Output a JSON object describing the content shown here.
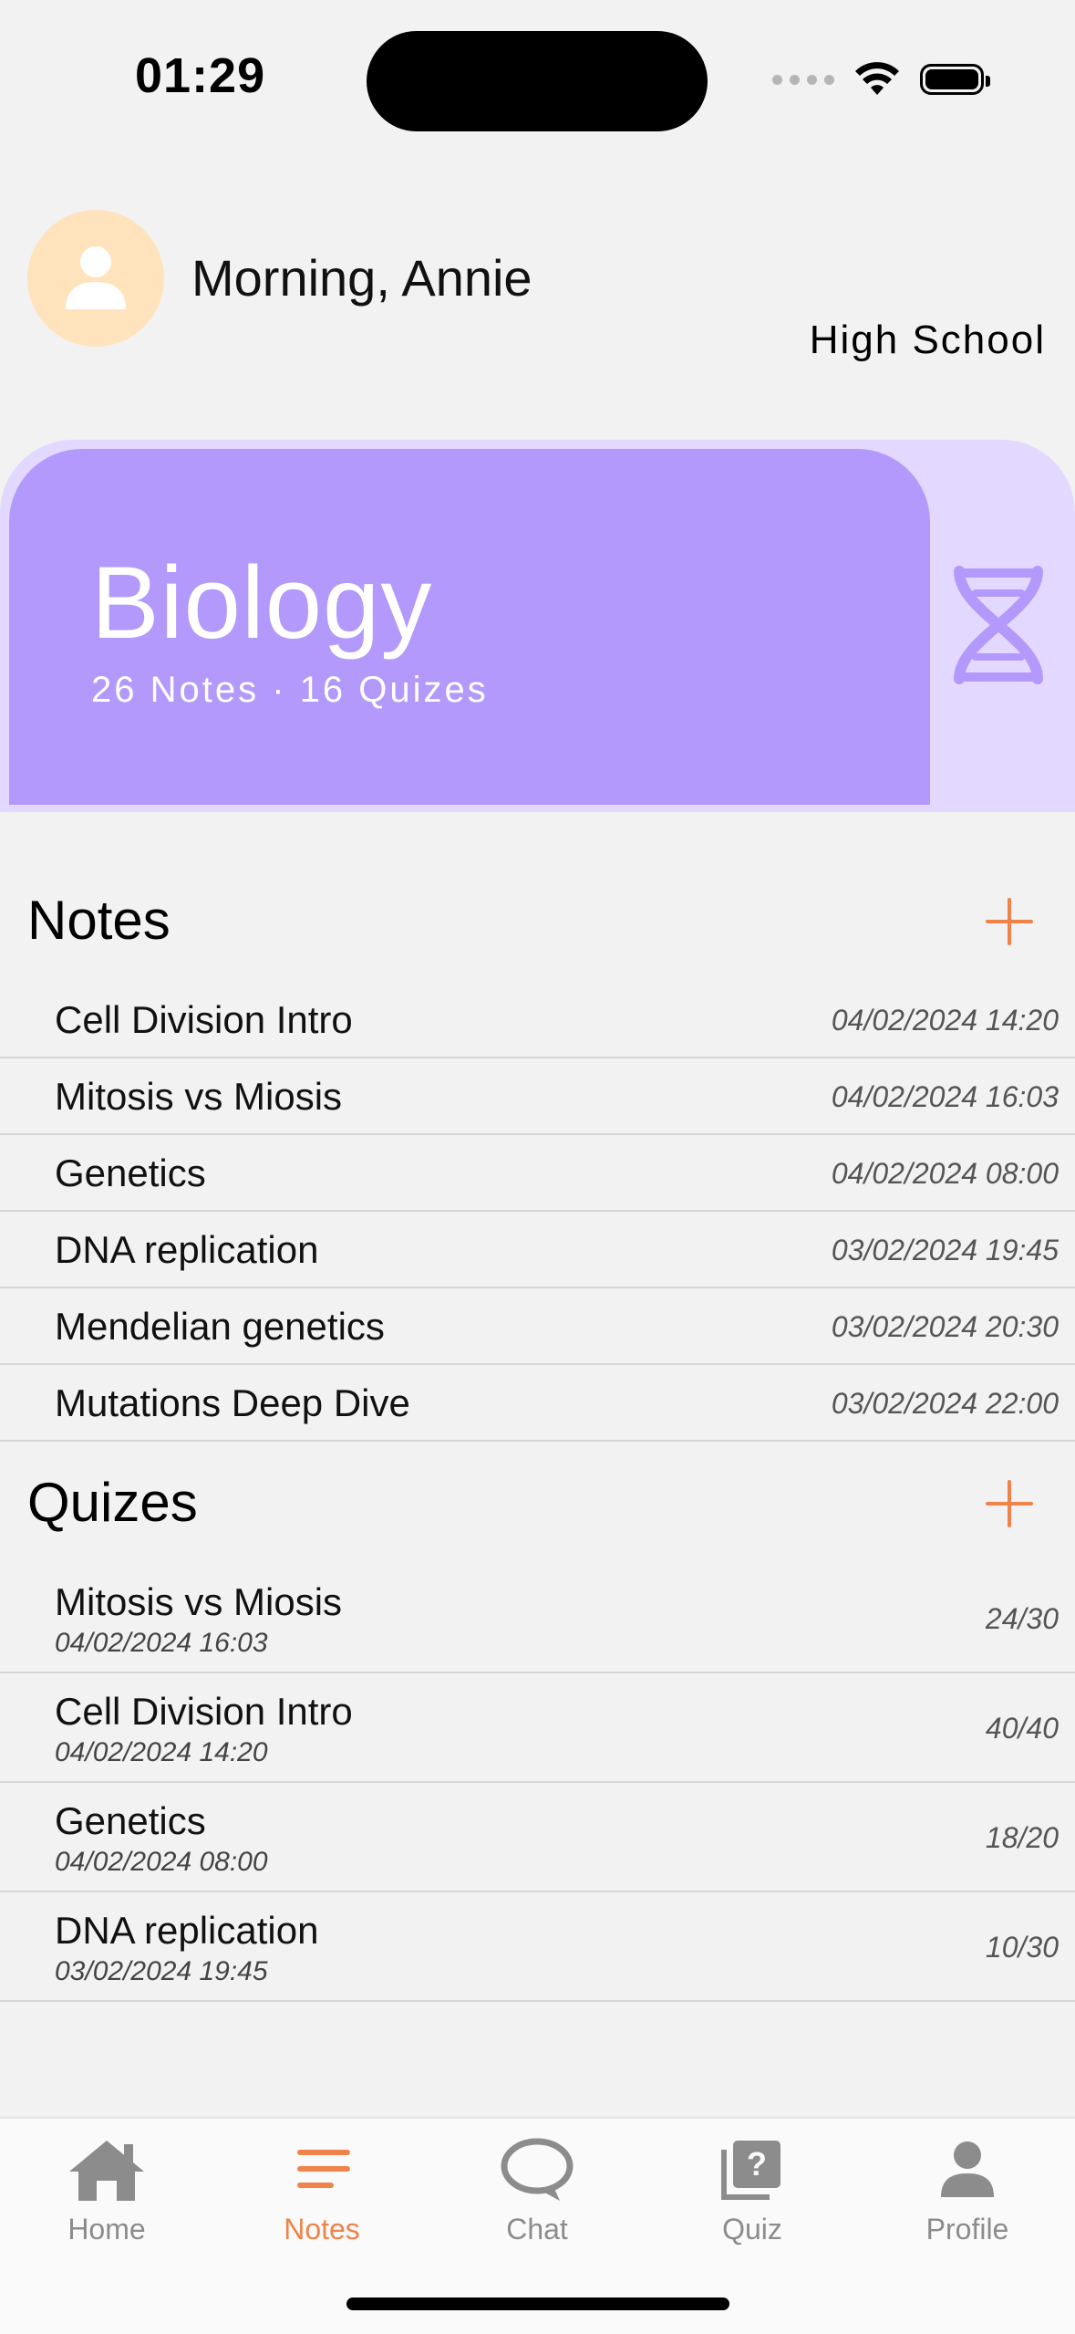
{
  "status_bar": {
    "time": "01:29"
  },
  "header": {
    "greeting": "Morning, Annie",
    "level": "High School"
  },
  "subject": {
    "title": "Biology",
    "stats": "26 Notes · 16 Quizes",
    "icon": "dna-icon"
  },
  "notes": {
    "title": "Notes",
    "items": [
      {
        "title": "Cell Division Intro",
        "date": "04/02/2024 14:20"
      },
      {
        "title": "Mitosis vs Miosis",
        "date": "04/02/2024 16:03"
      },
      {
        "title": "Genetics",
        "date": "04/02/2024 08:00"
      },
      {
        "title": "DNA replication",
        "date": "03/02/2024 19:45"
      },
      {
        "title": "Mendelian genetics",
        "date": "03/02/2024 20:30"
      },
      {
        "title": "Mutations Deep Dive",
        "date": "03/02/2024 22:00"
      }
    ]
  },
  "quizzes": {
    "title": "Quizes",
    "items": [
      {
        "title": "Mitosis vs Miosis",
        "date": "04/02/2024 16:03",
        "score": "24/30"
      },
      {
        "title": "Cell Division Intro",
        "date": "04/02/2024 14:20",
        "score": "40/40"
      },
      {
        "title": "Genetics",
        "date": "04/02/2024 08:00",
        "score": "18/20"
      },
      {
        "title": "DNA replication",
        "date": "03/02/2024 19:45",
        "score": "10/30"
      }
    ]
  },
  "tabs": [
    {
      "label": "Home",
      "icon": "home-icon"
    },
    {
      "label": "Notes",
      "icon": "notes-icon",
      "active": true
    },
    {
      "label": "Chat",
      "icon": "chat-icon"
    },
    {
      "label": "Quiz",
      "icon": "quiz-icon"
    },
    {
      "label": "Profile",
      "icon": "profile-icon"
    }
  ],
  "colors": {
    "accent": "#f0834a",
    "card": "#b399fc",
    "card_bg": "#e3d8ff",
    "avatar_bg": "#ffe3bd"
  }
}
